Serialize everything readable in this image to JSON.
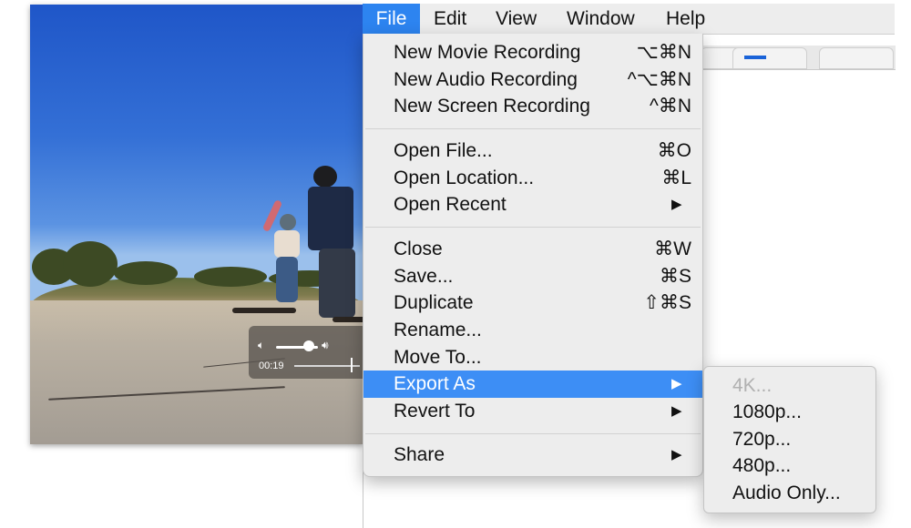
{
  "menubar": {
    "items": [
      {
        "label": "File",
        "active": true
      },
      {
        "label": "Edit"
      },
      {
        "label": "View"
      },
      {
        "label": "Window"
      },
      {
        "label": "Help"
      }
    ]
  },
  "file_menu": {
    "items": [
      {
        "label": "New Movie Recording",
        "shortcut": "⌥⌘N"
      },
      {
        "label": "New Audio Recording",
        "shortcut": "^⌥⌘N"
      },
      {
        "label": "New Screen Recording",
        "shortcut": "^⌘N"
      },
      {
        "label": "Open File...",
        "shortcut": "⌘O"
      },
      {
        "label": "Open Location...",
        "shortcut": "⌘L"
      },
      {
        "label": "Open Recent",
        "submenu": true
      },
      {
        "label": "Close",
        "shortcut": "⌘W"
      },
      {
        "label": "Save...",
        "shortcut": "⌘S"
      },
      {
        "label": "Duplicate",
        "shortcut": "⇧⌘S"
      },
      {
        "label": "Rename..."
      },
      {
        "label": "Move To..."
      },
      {
        "label": "Export As",
        "submenu": true,
        "highlighted": true
      },
      {
        "label": "Revert To",
        "submenu": true
      },
      {
        "label": "Share",
        "submenu": true
      }
    ],
    "arrow_glyph": "▶"
  },
  "export_submenu": {
    "items": [
      {
        "label": "4K...",
        "disabled": true
      },
      {
        "label": "1080p..."
      },
      {
        "label": "720p..."
      },
      {
        "label": "480p..."
      },
      {
        "label": "Audio Only..."
      }
    ]
  },
  "player": {
    "time": "00:19",
    "volume_fraction": 0.78,
    "playhead_fraction": 0.86,
    "volume_low_icon": "speaker-low-icon",
    "volume_high_icon": "speaker-high-icon"
  },
  "colors": {
    "menu_bg": "#ededed",
    "highlight": "#3d8ef5",
    "menubar_active": "#2d84f0",
    "disabled_text": "#b1b1b1"
  }
}
